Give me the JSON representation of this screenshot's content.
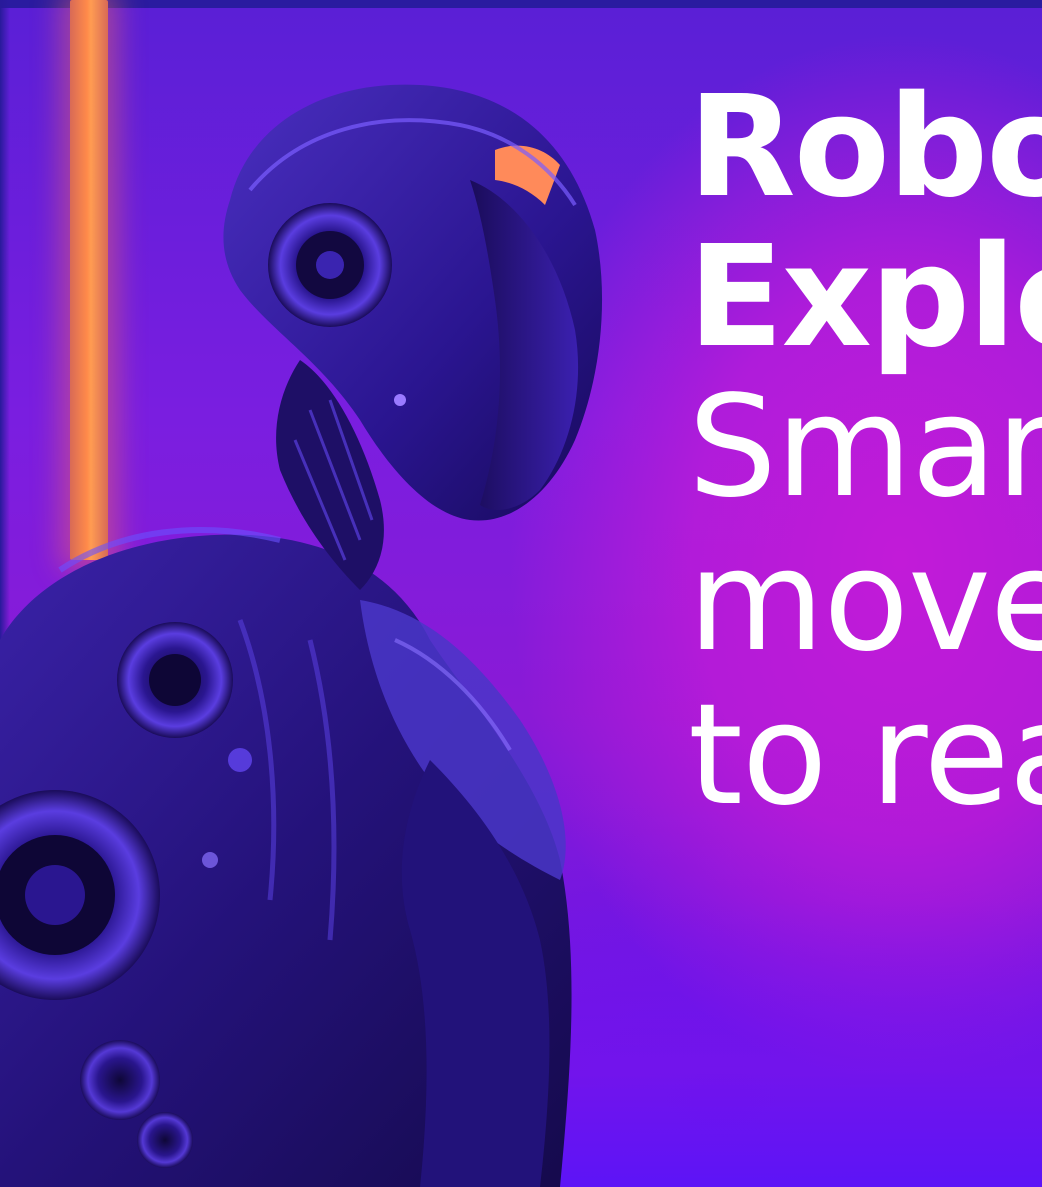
{
  "hero": {
    "title_line_1": "Robo",
    "title_line_2": "Explo",
    "subtitle_line_1": "Smar",
    "subtitle_line_2": "move",
    "subtitle_line_3": "to rea"
  },
  "image": {
    "subject": "robot-in-profile",
    "colors": {
      "background": "#8a1ad6",
      "magenta_glow": "#c21bd8",
      "neon_strip": "#ff8a4a",
      "robot_dark": "#1a0c4a",
      "robot_highlight": "#6a4cff",
      "text": "#ffffff"
    }
  }
}
